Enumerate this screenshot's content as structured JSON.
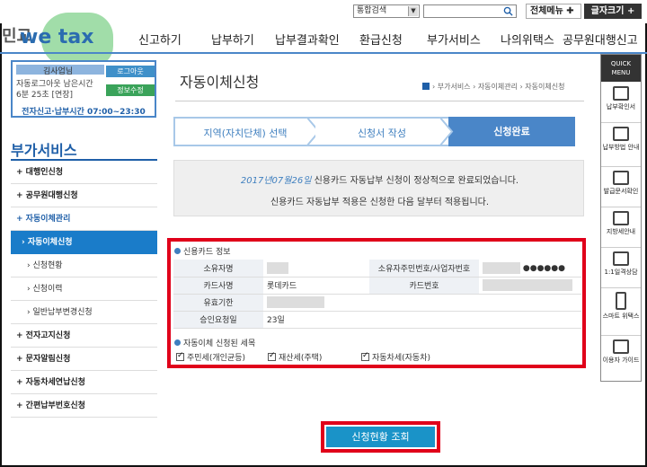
{
  "topbar": {
    "search_select": "통합검색",
    "full_menu": "전체메뉴 ✚",
    "font_size": "글자크기 +"
  },
  "logo": {
    "text": "we tax",
    "prefix": "민교"
  },
  "nav": [
    "신고하기",
    "납부하기",
    "납부결과확인",
    "환급신청",
    "부가서비스",
    "나의위택스",
    "공무원대행신고"
  ],
  "login": {
    "name": "김사업님",
    "line2": "자동로그아웃 남은시간",
    "line3": "6분 25초 [연장]",
    "logout": "로그아웃",
    "info_edit": "정보수정",
    "hours": "전자신고·납부시간 07:00~23:30"
  },
  "sidebar": {
    "title": "부가서비스",
    "items": [
      {
        "label": "+ 대행인신청",
        "type": "main"
      },
      {
        "label": "+ 공무원대행신청",
        "type": "main"
      },
      {
        "label": "+ 자동이체관리",
        "type": "open"
      },
      {
        "label": "› 자동이체신청",
        "type": "active"
      },
      {
        "label": "› 신청현황",
        "type": "sub"
      },
      {
        "label": "› 신청이력",
        "type": "sub"
      },
      {
        "label": "› 일반납부변경신청",
        "type": "sub"
      },
      {
        "label": "+ 전자고지신청",
        "type": "main"
      },
      {
        "label": "+ 문자알림신청",
        "type": "main"
      },
      {
        "label": "+ 자동차세연납신청",
        "type": "main"
      },
      {
        "label": "+ 간편납부번호신청",
        "type": "main"
      }
    ]
  },
  "content": {
    "title": "자동이체신청",
    "breadcrumb": "› 부가서비스 › 자동이체관리 › 자동이체신청",
    "steps": [
      "지역(자치단체) 선택",
      "신청서 작성",
      "신청완료"
    ],
    "notice_date": "2017년07월26일",
    "notice_line1": " 신용카드 자동납부 신청이 정상적으로 완료되었습니다.",
    "notice_line2": "신용카드 자동납부 적용은 신청한 다음 달부터 적용됩니다."
  },
  "card_info": {
    "heading": "신용카드 정보",
    "owner_label": "소유자명",
    "owner_value": "",
    "reg_label": "소유자주민번호/사업자번호",
    "reg_value": "●●●●●●",
    "card_company_label": "카드사명",
    "card_company_value": "롯데카드",
    "card_number_label": "카드번호",
    "card_number_value": "",
    "expiry_label": "유효기한",
    "expiry_value": "",
    "approval_day_label": "승인요청일",
    "approval_day_value": "23일"
  },
  "tax_items": {
    "heading": "자동이체 신청된 세목",
    "items": [
      "주민세(개인균등)",
      "재산세(주택)",
      "자동차세(자동차)"
    ]
  },
  "status_button": "신청현황 조회",
  "quick_menu": {
    "head": "QUICK MENU",
    "items": [
      "납부확인서",
      "납부방법 안내",
      "발급문서확인",
      "지방세안내",
      "1:1일격상담",
      "스마트 위택스",
      "이용자 가이드"
    ]
  }
}
